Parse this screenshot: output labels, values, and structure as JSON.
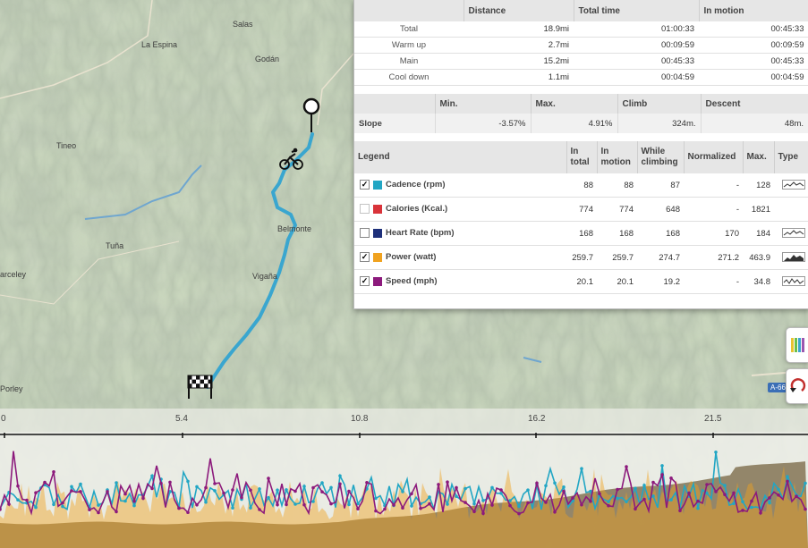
{
  "map": {
    "places": [
      {
        "label": "Salas"
      },
      {
        "label": "La Espina"
      },
      {
        "label": "Godán"
      },
      {
        "label": "Tineo"
      },
      {
        "label": "Belmonte"
      },
      {
        "label": "Tuña"
      },
      {
        "label": "arceley"
      },
      {
        "label": "Vigaña"
      },
      {
        "label": "Porley"
      },
      {
        "label": "A-66"
      }
    ],
    "route_color": "#3aa6cf"
  },
  "summary": {
    "headers": [
      "",
      "Distance",
      "Total time",
      "In motion"
    ],
    "rows": [
      {
        "label": "Total",
        "distance": "18.9mi",
        "total_time": "01:00:33",
        "in_motion": "00:45:33"
      },
      {
        "label": "Warm up",
        "distance": "2.7mi",
        "total_time": "00:09:59",
        "in_motion": "00:09:59"
      },
      {
        "label": "Main",
        "distance": "15.2mi",
        "total_time": "00:45:33",
        "in_motion": "00:45:33"
      },
      {
        "label": "Cool down",
        "distance": "1.1mi",
        "total_time": "00:04:59",
        "in_motion": "00:04:59"
      }
    ]
  },
  "slope": {
    "headers": [
      "",
      "Min.",
      "Max.",
      "Climb",
      "Descent"
    ],
    "row": {
      "label": "Slope",
      "min": "-3.57%",
      "max": "4.91%",
      "climb": "324m.",
      "descent": "48m."
    }
  },
  "legend": {
    "headers": [
      "Legend",
      "In total",
      "In motion",
      "While climbing",
      "Normalized",
      "Max.",
      "Type"
    ],
    "rows": [
      {
        "checked": true,
        "color": "#22a6c4",
        "label": "Cadence (rpm)",
        "in_total": "88",
        "in_motion": "88",
        "while_climbing": "87",
        "normalized": "-",
        "max": "128",
        "type": true
      },
      {
        "checked": false,
        "color": "#d9333a",
        "label": "Calories (Kcal.)",
        "in_total": "774",
        "in_motion": "774",
        "while_climbing": "648",
        "normalized": "-",
        "max": "1821",
        "type": false
      },
      {
        "checked": false,
        "color": "#1d2f7a",
        "label": "Heart Rate (bpm)",
        "in_total": "168",
        "in_motion": "168",
        "while_climbing": "168",
        "normalized": "170",
        "max": "184",
        "type": true
      },
      {
        "checked": true,
        "color": "#f0a21f",
        "label": "Power (watt)",
        "in_total": "259.7",
        "in_motion": "259.7",
        "while_climbing": "274.7",
        "normalized": "271.2",
        "max": "463.9",
        "type": true
      },
      {
        "checked": true,
        "color": "#8c1a7c",
        "label": "Speed (mph)",
        "in_total": "20.1",
        "in_motion": "20.1",
        "while_climbing": "19.2",
        "normalized": "-",
        "max": "34.8",
        "type": true
      }
    ]
  },
  "elevation_chart": {
    "axis_ticks": [
      "0",
      "5.4",
      "10.8",
      "16.2",
      "21.5"
    ],
    "series_colors": {
      "cadence": "#22a6c4",
      "power": "#f0a21f",
      "speed": "#8c1a7c",
      "elevation": "#7a6a4a"
    }
  }
}
